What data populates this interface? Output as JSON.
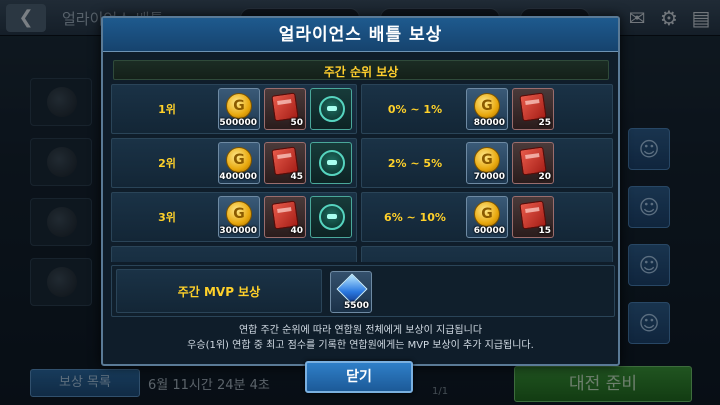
{
  "background": {
    "title": "얼라이언스 배틀",
    "back_icon": "back-arrow-icon",
    "bottom_button": "보상 목록",
    "timer": "6월 11시간 24분 4초",
    "page": "1/1",
    "ready_button": "대전 준비"
  },
  "modal": {
    "title": "얼라이언스 배틀 보상",
    "weekly_header": "주간 순위 보상",
    "rank_rows": [
      {
        "left_label": "1위",
        "left_rewards": [
          {
            "icon": "gold-coin-icon",
            "qty": "500000"
          },
          {
            "icon": "red-box-icon",
            "qty": "50"
          },
          {
            "icon": "helmet-icon",
            "qty": ""
          }
        ],
        "right_label": "0% ~ 1%",
        "right_rewards": [
          {
            "icon": "gold-coin-icon",
            "qty": "80000"
          },
          {
            "icon": "red-box-icon",
            "qty": "25"
          }
        ]
      },
      {
        "left_label": "2위",
        "left_rewards": [
          {
            "icon": "gold-coin-icon",
            "qty": "400000"
          },
          {
            "icon": "red-box-icon",
            "qty": "45"
          },
          {
            "icon": "helmet-icon",
            "qty": ""
          }
        ],
        "right_label": "2% ~ 5%",
        "right_rewards": [
          {
            "icon": "gold-coin-icon",
            "qty": "70000"
          },
          {
            "icon": "red-box-icon",
            "qty": "20"
          }
        ]
      },
      {
        "left_label": "3위",
        "left_rewards": [
          {
            "icon": "gold-coin-icon",
            "qty": "300000"
          },
          {
            "icon": "red-box-icon",
            "qty": "40"
          },
          {
            "icon": "helmet-icon",
            "qty": ""
          }
        ],
        "right_label": "6% ~ 10%",
        "right_rewards": [
          {
            "icon": "gold-coin-icon",
            "qty": "60000"
          },
          {
            "icon": "red-box-icon",
            "qty": "15"
          }
        ]
      }
    ],
    "mvp_label": "주간 MVP 보상",
    "mvp_reward": {
      "icon": "crystal-icon",
      "qty": "5500"
    },
    "notes": [
      "연합 주간 순위에 따라 연합원 전체에게 보상이 지급됩니다",
      "우승(1위) 연합 중 최고 점수를 기록한 연합원에게는 MVP 보상이 추가 지급됩니다."
    ],
    "close_button": "닫기"
  }
}
